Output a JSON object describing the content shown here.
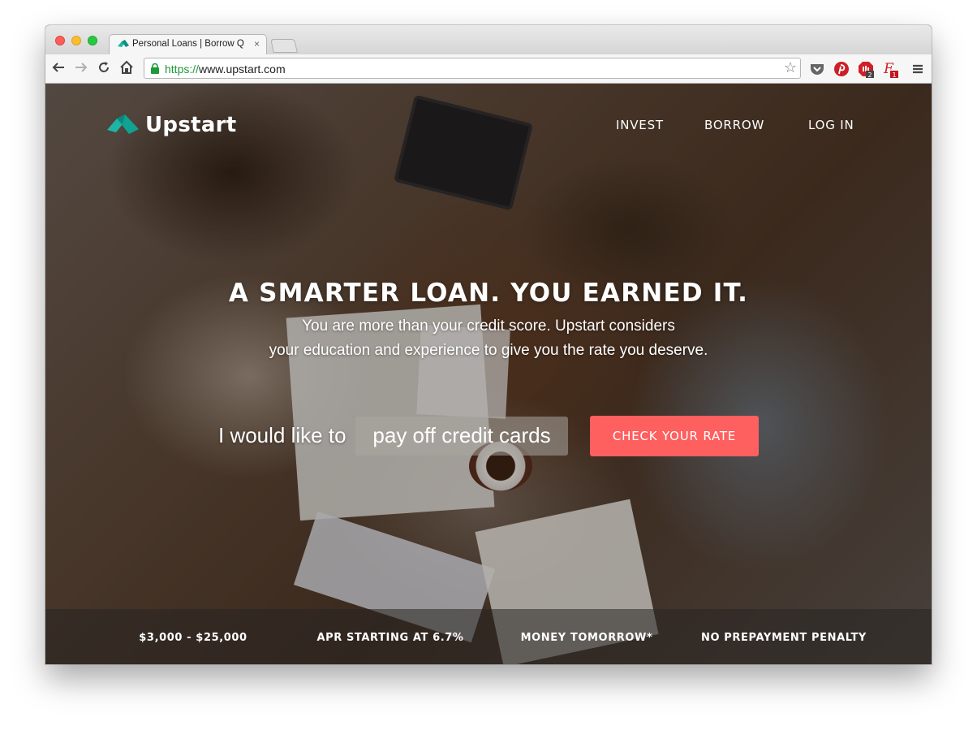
{
  "browser": {
    "tab_title": "Personal Loans | Borrow Q",
    "tab_close": "×",
    "url_scheme": "https://",
    "url_rest": "www.upstart.com",
    "extensions": [
      "pocket-icon",
      "pinterest-icon",
      "adblock-icon",
      "font-extension-icon",
      "menu-icon"
    ],
    "extension_badges": {
      "adblock": "2",
      "font": "1"
    }
  },
  "nav": {
    "logo_text": "Upstart",
    "links": [
      "INVEST",
      "BORROW",
      "LOG IN"
    ]
  },
  "hero": {
    "headline": "A SMARTER LOAN. YOU EARNED IT.",
    "subline_1": "You are more than your credit score. Upstart considers",
    "subline_2": "your education and experience to give you the rate you deserve.",
    "form_label": "I would like to",
    "purpose_selected": "pay off credit cards",
    "cta_label": "CHECK YOUR RATE"
  },
  "features": [
    "$3,000 - $25,000",
    "APR STARTING AT 6.7%",
    "MONEY TOMORROW*",
    "NO PREPAYMENT PENALTY"
  ],
  "colors": {
    "brand_teal": "#1fb5a5",
    "cta_coral": "#fe5f5f",
    "secure_green": "#1e9a37"
  }
}
